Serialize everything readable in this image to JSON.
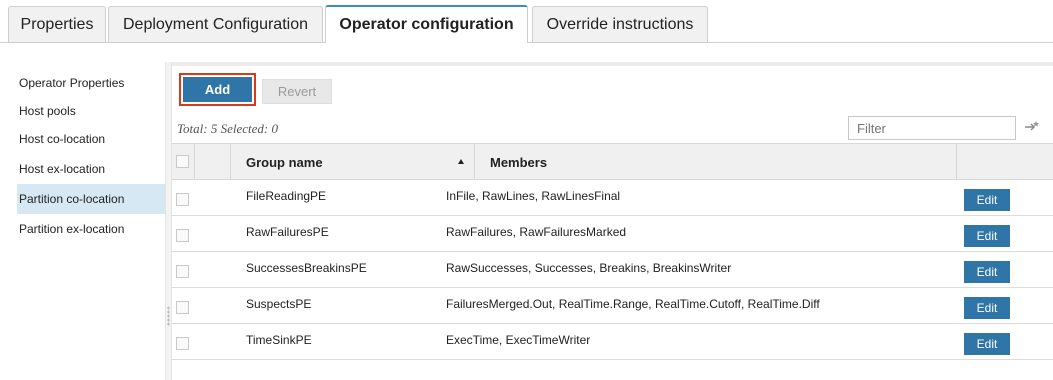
{
  "tabs": [
    {
      "label": "Properties",
      "active": false
    },
    {
      "label": "Deployment Configuration",
      "active": false
    },
    {
      "label": "Operator configuration",
      "active": true
    },
    {
      "label": "Override instructions",
      "active": false
    }
  ],
  "sidebar": {
    "items": [
      {
        "label": "Operator Properties",
        "selected": false
      },
      {
        "label": "Host pools",
        "selected": false
      },
      {
        "label": "Host co-location",
        "selected": false
      },
      {
        "label": "Host ex-location",
        "selected": false
      },
      {
        "label": "Partition co-location",
        "selected": true
      },
      {
        "label": "Partition ex-location",
        "selected": false
      }
    ]
  },
  "toolbar": {
    "add_label": "Add",
    "revert_label": "Revert",
    "summary": "Total: 5 Selected: 0",
    "filter_placeholder": "Filter"
  },
  "table": {
    "columns": [
      "Group name",
      "Members"
    ],
    "sort": {
      "column": "Group name",
      "direction": "ascending"
    },
    "edit_label": "Edit",
    "rows": [
      {
        "group": "FileReadingPE",
        "members": "InFile, RawLines, RawLinesFinal"
      },
      {
        "group": "RawFailuresPE",
        "members": "RawFailures, RawFailuresMarked"
      },
      {
        "group": "SuccessesBreakinsPE",
        "members": "RawSuccesses, Successes, Breakins, BreakinsWriter"
      },
      {
        "group": "SuspectsPE",
        "members": "FailuresMerged.Out, RealTime.Range, RealTime.Cutoff, RealTime.Diff"
      },
      {
        "group": "TimeSinkPE",
        "members": "ExecTime, ExecTimeWriter"
      }
    ]
  },
  "colors": {
    "accent": "#2f75a8",
    "highlight_border": "#d93a1d",
    "selected_nav": "#d6e8f3",
    "active_tab_top": "#3a8ec2"
  }
}
